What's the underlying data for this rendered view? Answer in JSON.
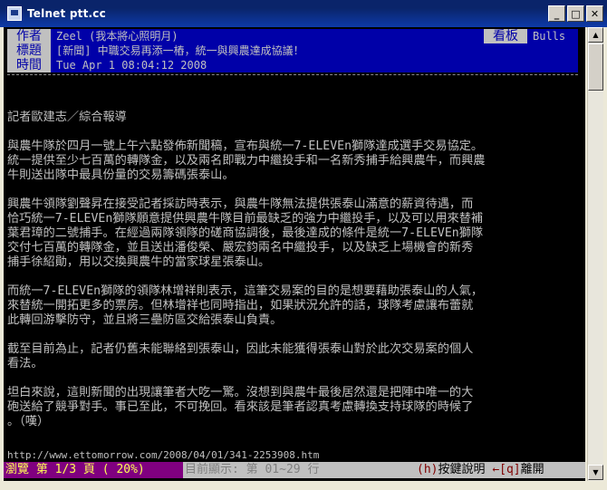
{
  "window": {
    "title": "Telnet ptt.cc"
  },
  "header": {
    "author_label": "作者",
    "author_value": "Zeel (我本將心照明月)",
    "title_label": "標題",
    "title_value": "[新聞] 中職交易再添一樁，統一與興農達成協議！",
    "time_label": "時間",
    "time_value": "Tue Apr  1 08:04:12 2008",
    "board_label": "看板",
    "board_value": "Bulls"
  },
  "body_lines": [
    "記者歐建志／綜合報導",
    "",
    "與農牛隊於四月一號上午六點發佈新聞稿，宣布與統一7-ELEVEn獅隊達成選手交易協定。",
    "統一提供至少七百萬的轉隊金，以及兩名即戰力中繼投手和一名新秀捕手給興農牛，而興農",
    "牛則送出隊中最具份量的交易籌碼張泰山。",
    "",
    "興農牛領隊劉聲昇在接受記者採訪時表示，與農牛隊無法提供張泰山滿意的薪資待遇，而",
    "恰巧統一7-ELEVEn獅隊願意提供興農牛隊目前最缺乏的強力中繼投手，以及可以用來替補",
    "葉君璋的二號捕手。在經過兩隊領隊的磋商協調後，最後達成的條件是統一7-ELEVEn獅隊",
    "交付七百萬的轉隊金，並且送出潘俊榮、嚴宏鈞兩名中繼投手，以及缺乏上場機會的新秀",
    "捕手徐紹勛，用以交換興農牛的當家球星張泰山。",
    "",
    "而統一7-ELEVEn獅隊的領隊林增祥則表示，這筆交易案的目的是想要藉助張泰山的人氣，",
    "來替統一開拓更多的票房。但林增祥也同時指出，如果狀況允許的話，球隊考慮讓布蕾就",
    "此轉回游擊防守，並且將三壘防區交給張泰山負責。",
    "",
    "截至目前為止，記者仍舊未能聯絡到張泰山，因此未能獲得張泰山對於此次交易案的個人",
    "看法。",
    "",
    "坦白來說，這則新聞的出現讓筆者大吃一驚。沒想到與農牛最後居然還是把陣中唯一的大",
    "砲送給了競爭對手。事已至此，不可挽回。看來該是筆者認真考慮轉換支持球隊的時候了",
    "。（嘆）"
  ],
  "url": "http://www.ettomorrow.com/2008/04/01/341-2253908.htm",
  "status": {
    "left": " 瀏覽 第 1/3 頁 ( 20%) ",
    "mid": " 目前顯示: 第 01~29 行",
    "help_key": "(h)",
    "help_label": "按鍵說明",
    "exit_key": "←[q]",
    "exit_label": "離開"
  },
  "colors": {
    "title_bar": "#0a246a",
    "header_bg": "#0000a8",
    "status_left_bg": "#800080",
    "status_left_fg": "#ffff55"
  }
}
